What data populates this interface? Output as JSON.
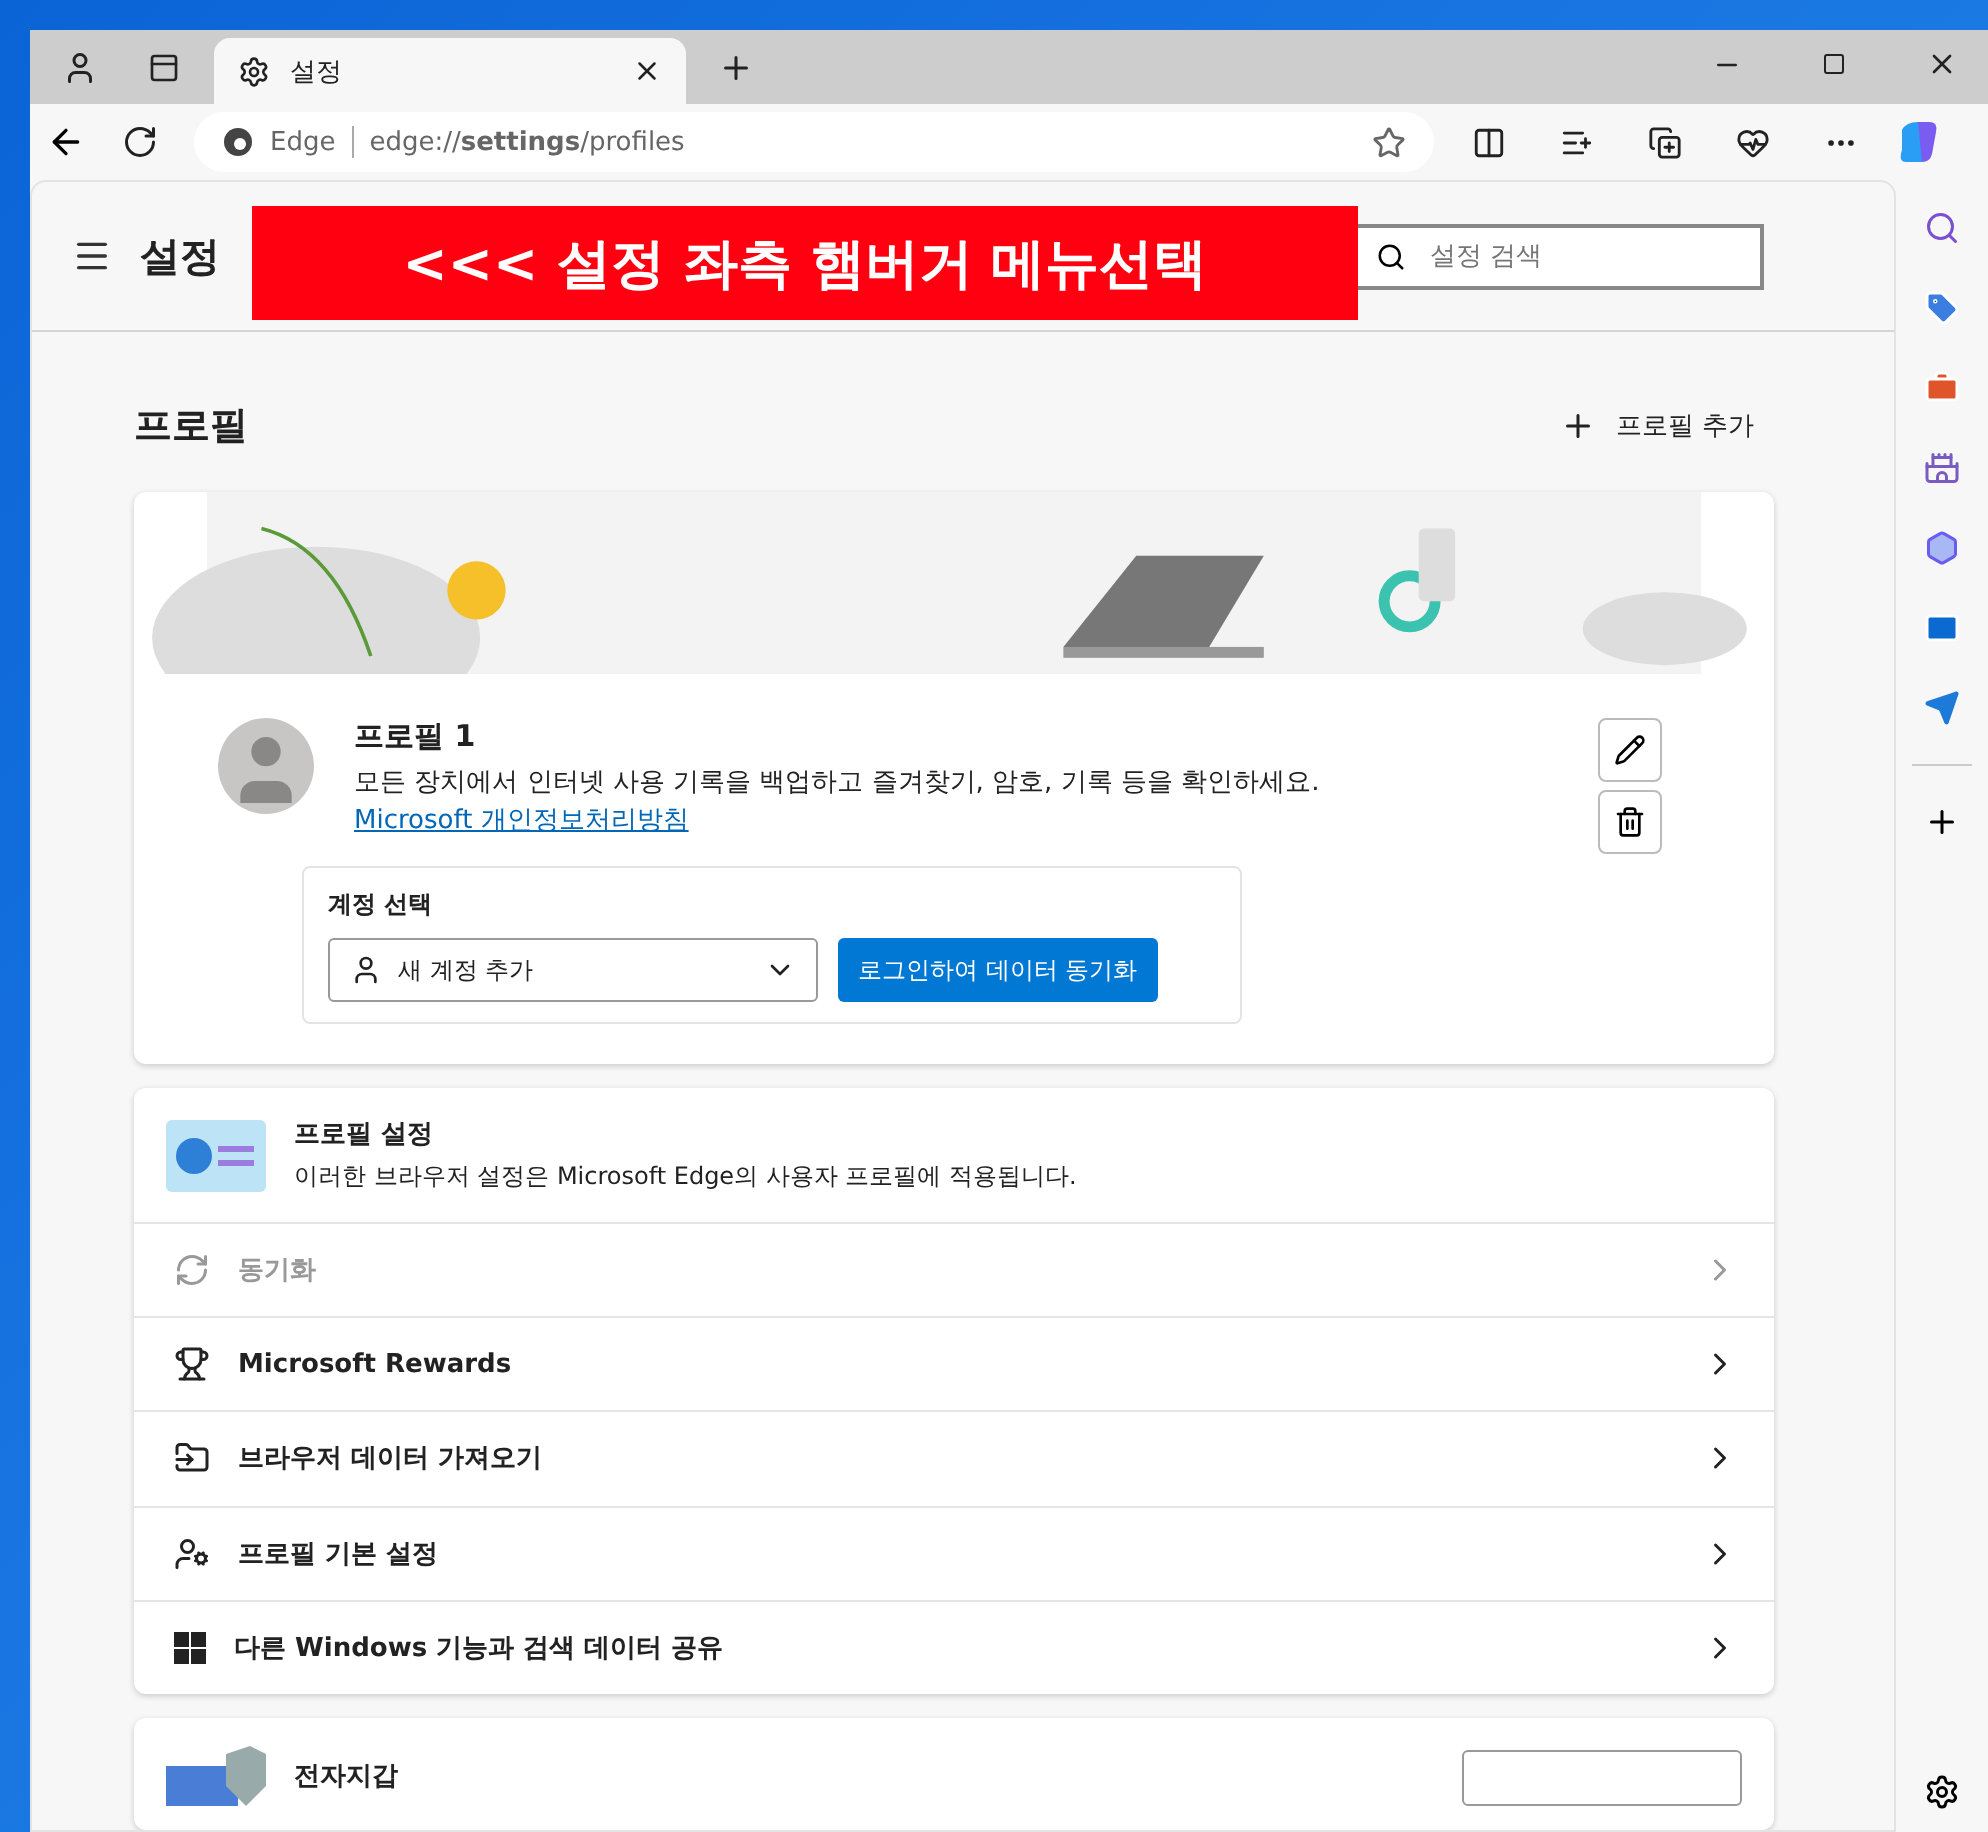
{
  "browser": {
    "tab": {
      "title": "설정"
    },
    "address": {
      "site_label": "Edge",
      "url": "edge://**settings**/profiles"
    }
  },
  "header": {
    "title": "설정",
    "search_placeholder": "설정 검색"
  },
  "annotation": "<<< 설정 좌측 햄버거 메뉴선택",
  "section": {
    "title": "프로필",
    "add_label": "프로필 추가"
  },
  "profile": {
    "name": "프로필 1",
    "description": "모든 장치에서 인터넷 사용 기록을 백업하고 즐겨찾기, 암호, 기록 등을 확인하세요.",
    "link": "Microsoft 개인정보처리방침",
    "account_label": "계정 선택",
    "account_value": "새 계정 추가",
    "sync_button": "로그인하여 데이터 동기화"
  },
  "settings_card": {
    "title": "프로필 설정",
    "subtitle": "이러한 브라우저 설정은 Microsoft Edge의 사용자 프로필에 적용됩니다.",
    "rows": [
      {
        "kind": "sync",
        "label": "동기화",
        "disabled": true
      },
      {
        "kind": "rewards",
        "label": "Microsoft Rewards",
        "disabled": false
      },
      {
        "kind": "import",
        "label": "브라우저 데이터 가져오기",
        "disabled": false
      },
      {
        "kind": "preferences",
        "label": "프로필 기본 설정",
        "disabled": false
      },
      {
        "kind": "windows",
        "label": "다른 Windows 기능과 검색 데이터 공유",
        "disabled": false
      }
    ]
  },
  "wallet_card": {
    "title": "전자지갑"
  }
}
